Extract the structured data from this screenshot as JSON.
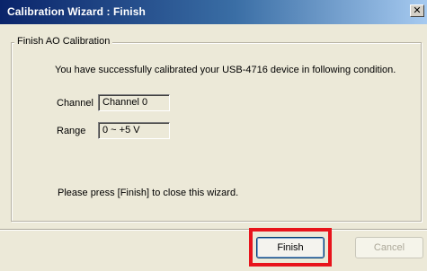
{
  "window": {
    "title": "Calibration Wizard : Finish",
    "close_glyph": "✕"
  },
  "group": {
    "label": "Finish AO Calibration",
    "message": "You have successfully calibrated your USB-4716 device in following condition."
  },
  "fields": {
    "channel_label": "Channel",
    "channel_value": "Channel 0",
    "range_label": "Range",
    "range_value": "0 ~ +5 V"
  },
  "hint": "Please press [Finish] to close this wizard.",
  "buttons": {
    "finish": "Finish",
    "cancel": "Cancel"
  },
  "colors": {
    "titlebar_start": "#0a246a",
    "titlebar_end": "#a6caf0",
    "highlight": "#e8141c",
    "dialog_bg": "#ece9d8"
  },
  "icons": {
    "close": "close-icon"
  },
  "state": {
    "cancel_enabled": false
  }
}
